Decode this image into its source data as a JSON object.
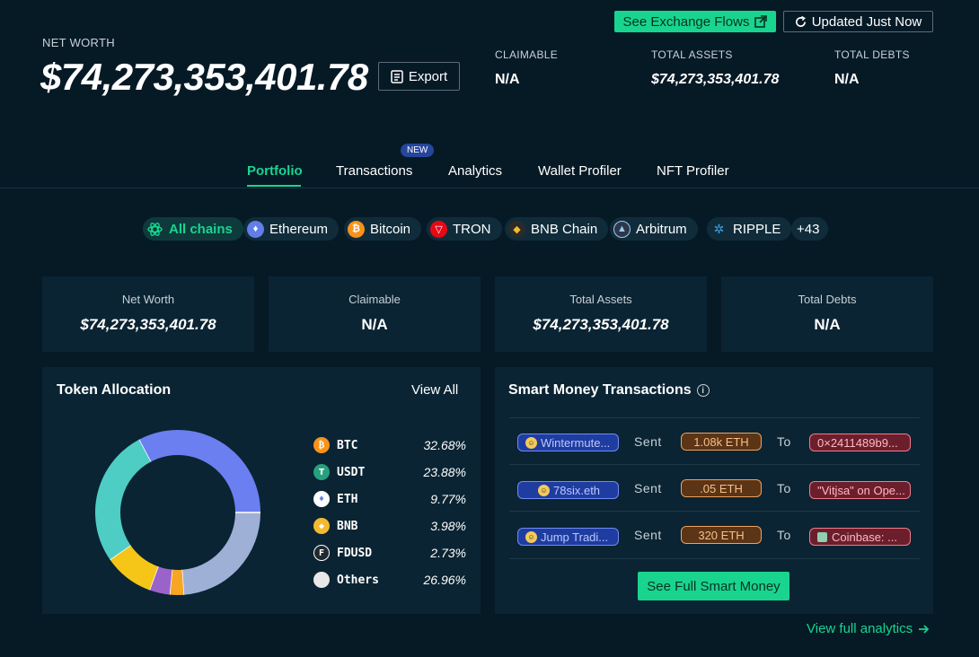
{
  "header": {
    "exchange_flows_label": "See Exchange Flows",
    "updated_label": "Updated Just Now",
    "net_worth_label": "NET WORTH",
    "net_worth_value": "$74,273,353,401.78",
    "export_label": "Export",
    "stats": [
      {
        "label": "CLAIMABLE",
        "value": "N/A"
      },
      {
        "label": "TOTAL ASSETS",
        "value": "$74,273,353,401.78"
      },
      {
        "label": "TOTAL DEBTS",
        "value": "N/A"
      }
    ]
  },
  "tabs": [
    {
      "label": "Portfolio",
      "active": true
    },
    {
      "label": "Transactions",
      "badge": "NEW"
    },
    {
      "label": "Analytics"
    },
    {
      "label": "Wallet Profiler"
    },
    {
      "label": "NFT Profiler"
    }
  ],
  "chains": [
    {
      "label": "All chains",
      "icon": "all-chains-icon",
      "color": "#19d48f"
    },
    {
      "label": "Ethereum",
      "icon": "ethereum-icon",
      "color": "#627eea"
    },
    {
      "label": "Bitcoin",
      "icon": "bitcoin-icon",
      "color": "#f7931a"
    },
    {
      "label": "TRON",
      "icon": "tron-icon",
      "color": "#e50915"
    },
    {
      "label": "BNB Chain",
      "icon": "bnb-icon",
      "color": "#f3ba2f"
    },
    {
      "label": "Arbitrum",
      "icon": "arbitrum-icon",
      "color": "#2d374b"
    },
    {
      "label": "RIPPLE",
      "icon": "ripple-icon",
      "color": "#23292f"
    },
    {
      "label": "+43"
    }
  ],
  "stat_cards": [
    {
      "label": "Net Worth",
      "value": "$74,273,353,401.78"
    },
    {
      "label": "Claimable",
      "value": "N/A"
    },
    {
      "label": "Total Assets",
      "value": "$74,273,353,401.78"
    },
    {
      "label": "Total Debts",
      "value": "N/A"
    }
  ],
  "token_allocation": {
    "title": "Token Allocation",
    "view_all_label": "View All"
  },
  "chart_data": {
    "type": "pie",
    "donut": true,
    "categories": [
      "BTC",
      "USDT",
      "ETH",
      "BNB",
      "FDUSD",
      "Others"
    ],
    "values": [
      32.68,
      23.88,
      9.77,
      3.98,
      2.73,
      26.96
    ],
    "labels": [
      "32.68%",
      "23.88%",
      "9.77%",
      "3.98%",
      "2.73%",
      "26.96%"
    ],
    "legend_position": "right",
    "legend_colors": [
      "#f7931a",
      "#26a17b",
      "#627eea",
      "#f3ba2f",
      "#1f2a30",
      "#e8e8e8"
    ],
    "slice_colors": [
      "#6b7ff0",
      "#9fb0d6",
      "#f5a623",
      "#9a63c9",
      "#f5c518",
      "#4ecdc4"
    ]
  },
  "smart_money": {
    "title": "Smart Money Transactions",
    "sent_word": "Sent",
    "to_word": "To",
    "rows": [
      {
        "from": "Wintermute...",
        "amount": "1.08k ETH",
        "to": "0×2411489b9..."
      },
      {
        "from": "78six.eth",
        "amount": ".05 ETH",
        "to": "\"Vitjsa\" on Ope..."
      },
      {
        "from": "Jump Tradi...",
        "amount": "320 ETH",
        "to": "Coinbase: ..."
      }
    ],
    "see_full_label": "See Full Smart Money"
  },
  "view_full_analytics_label": "View full analytics"
}
